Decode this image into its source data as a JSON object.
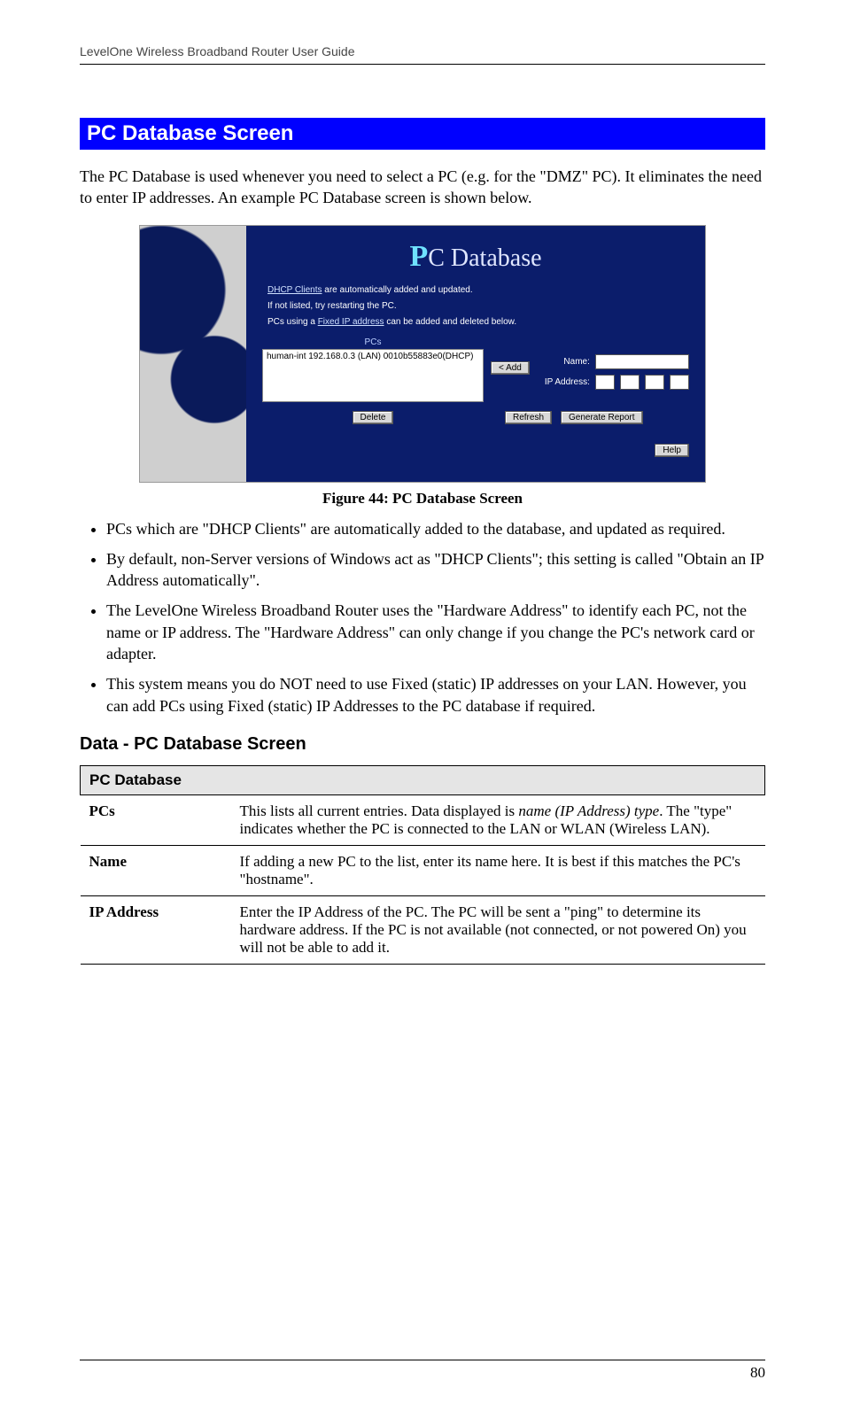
{
  "header": {
    "running_head": "LevelOne Wireless Broadband Router User Guide"
  },
  "section": {
    "title": "PC Database Screen",
    "intro": "The PC Database is used whenever you need to select a PC (e.g. for the \"DMZ\" PC). It eliminates the need to enter IP addresses. An example PC Database screen is shown below."
  },
  "screenshot": {
    "title_big": "P",
    "title_rest": "C Database",
    "note1_a": "DHCP Clients",
    "note1_b": " are automatically added and updated.",
    "note2": "If not listed, try restarting the PC.",
    "note3_a": "PCs using a ",
    "note3_b": "Fixed IP address",
    "note3_c": " can be added and deleted below.",
    "pcs_label": "PCs",
    "pcs_entry": "human-int 192.168.0.3 (LAN) 0010b55883e0(DHCP)",
    "btn_add": "< Add",
    "lbl_name": "Name:",
    "lbl_ip": "IP Address:",
    "btn_delete": "Delete",
    "btn_refresh": "Refresh",
    "btn_report": "Generate Report",
    "btn_help": "Help"
  },
  "figure_caption": "Figure 44: PC Database Screen",
  "bullets": [
    "PCs which are \"DHCP Clients\" are automatically added to the database, and updated as required.",
    "By default, non-Server versions of Windows act as \"DHCP Clients\"; this setting is called \"Obtain an IP Address automatically\".",
    "The LevelOne Wireless Broadband Router uses the \"Hardware Address\" to identify each PC, not the name or IP address. The \"Hardware Address\" can only change if you change the PC's network card or adapter.",
    "This system means you do NOT need to use Fixed (static) IP addresses on your LAN. However, you can add PCs using Fixed (static) IP Addresses to the PC database if required."
  ],
  "data_heading": "Data - PC Database Screen",
  "table": {
    "group": "PC Database",
    "rows": [
      {
        "key": "PCs",
        "val_a": "This lists all current entries. Data displayed is ",
        "val_i": "name (IP Address) type",
        "val_b": ". The \"type\" indicates whether the PC is connected to the LAN or WLAN (Wireless LAN)."
      },
      {
        "key": "Name",
        "val": "If adding a new PC to the list, enter its name here. It is best if this matches the PC's \"hostname\"."
      },
      {
        "key": "IP Address",
        "val": "Enter the IP Address of the PC. The PC will be sent a \"ping\" to determine its hardware address. If the PC is not available (not connected, or not powered On) you will not be able to add it."
      }
    ]
  },
  "page_number": "80"
}
